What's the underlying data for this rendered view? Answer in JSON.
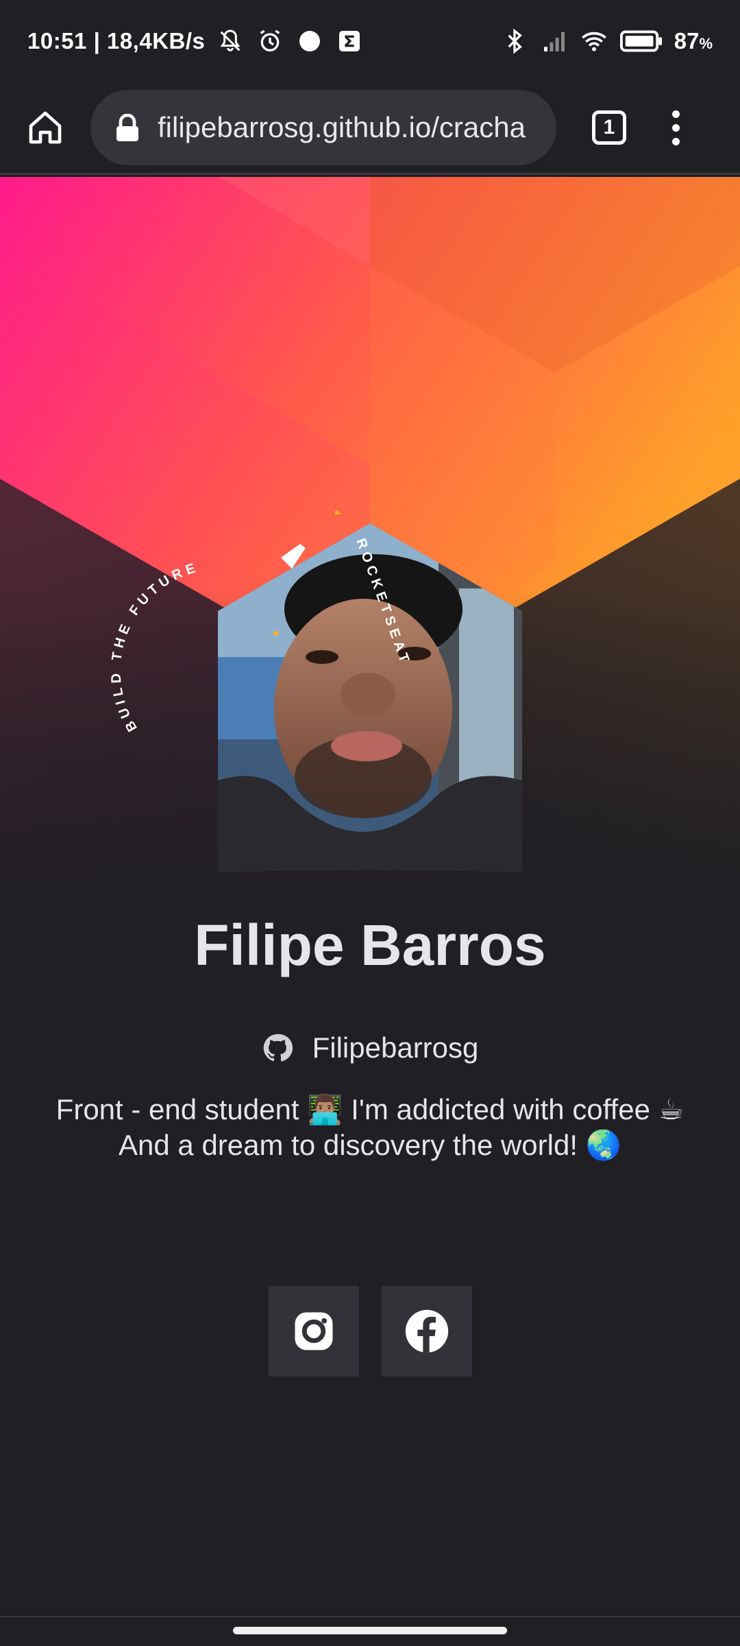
{
  "status_bar": {
    "time_speed": "10:51 | 18,4KB/s",
    "battery_percent": "87",
    "battery_unit": "%",
    "icons": [
      "muted-bell-icon",
      "alarm-icon",
      "dot-icon",
      "sigma-icon",
      "bluetooth-icon",
      "signal-icon",
      "wifi-icon",
      "battery-icon"
    ]
  },
  "browser": {
    "url": "filipebarrosg.github.io/cracha",
    "tab_count": "1"
  },
  "hero": {
    "ring_text": "BUILD THE FUTURE",
    "ring_text_2": "ROCKETSEAT",
    "colors": {
      "pink": "#ff1a8c",
      "orange": "#ff7a3c",
      "yellow": "#ffaa2a",
      "background": "#201f24"
    }
  },
  "profile": {
    "name": "Filipe Barros",
    "github_username": "Filipebarrosg",
    "bio_line_1": "Front - end student 👨🏽‍💻 I'm addicted with coffee ☕",
    "bio_line_2": "And a dream to discovery the world! 🌏"
  },
  "socials": [
    {
      "icon": "instagram-icon"
    },
    {
      "icon": "facebook-icon"
    }
  ]
}
